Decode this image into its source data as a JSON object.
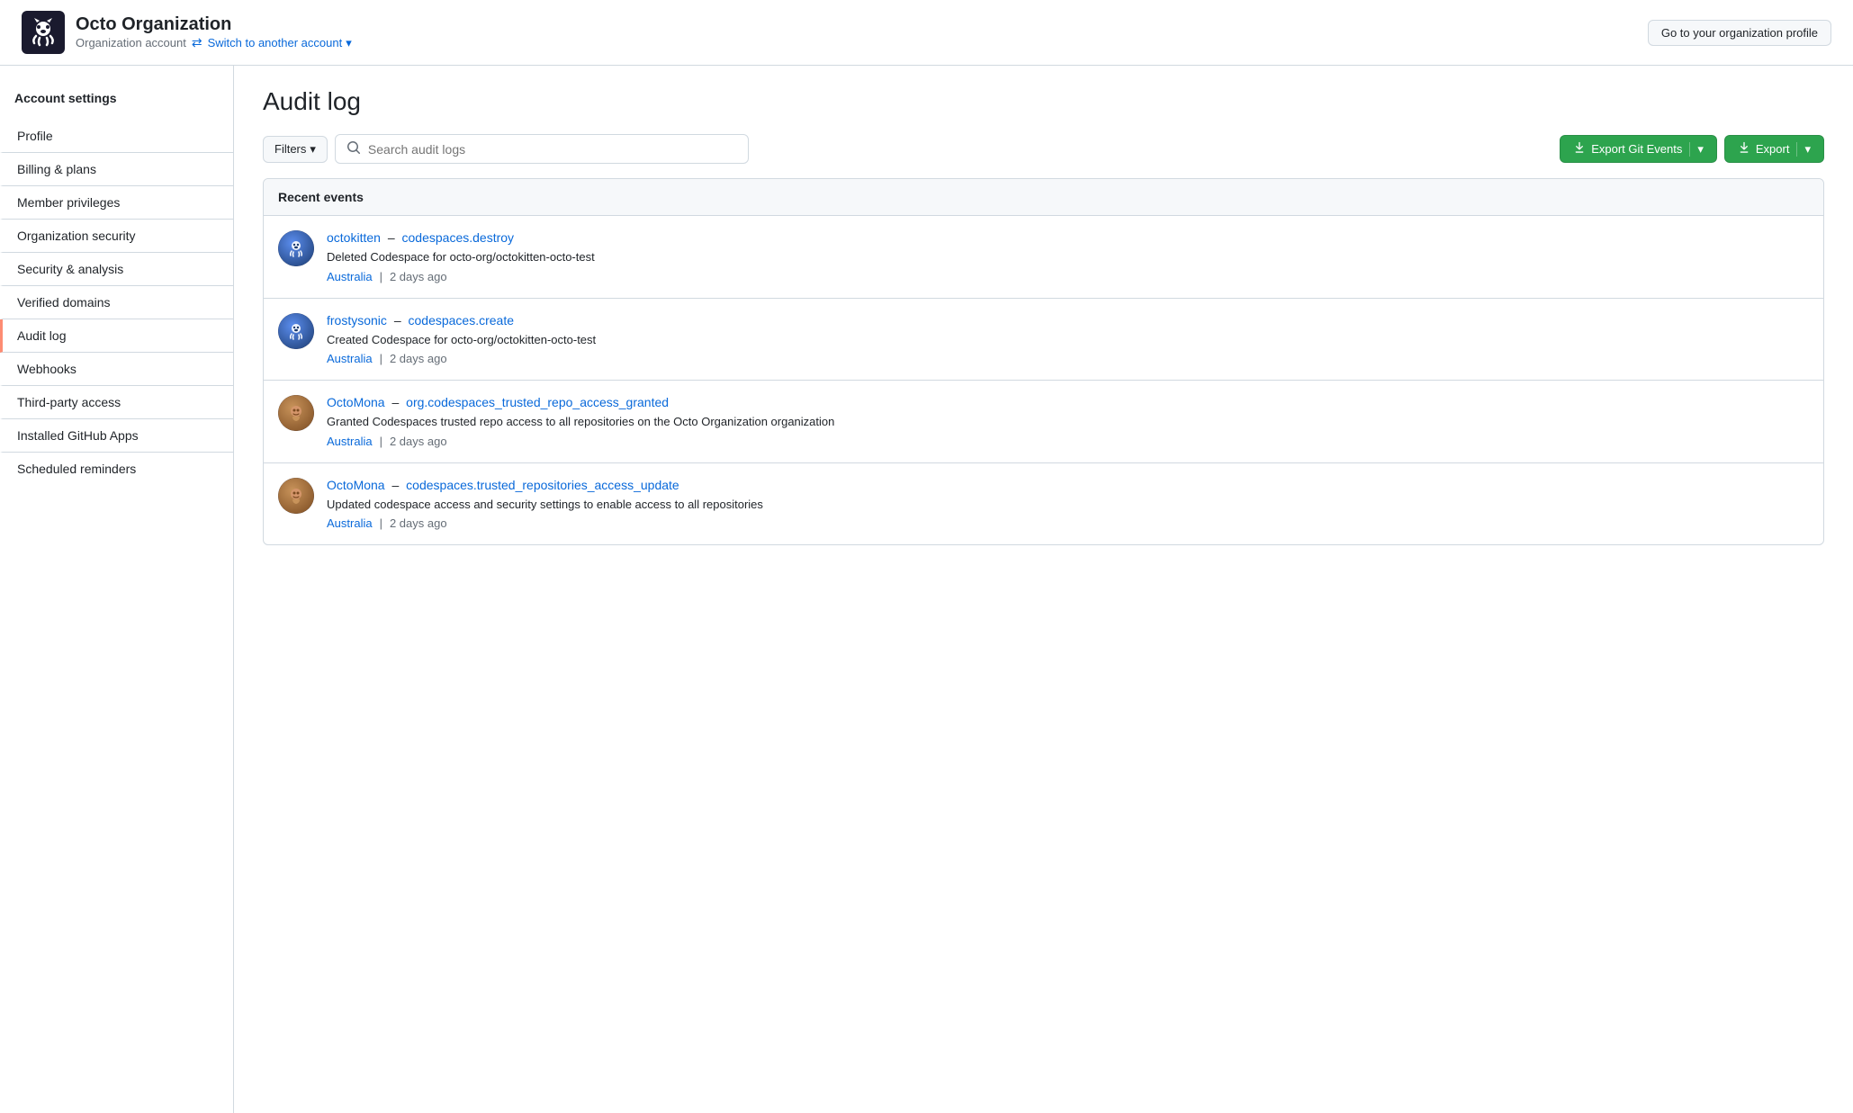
{
  "header": {
    "org_name": "Octo Organization",
    "org_type": "Organization account",
    "switch_label": "Switch to another account",
    "profile_btn": "Go to your organization profile"
  },
  "sidebar": {
    "title": "Account settings",
    "items": [
      {
        "label": "Profile",
        "active": false
      },
      {
        "label": "Billing & plans",
        "active": false
      },
      {
        "label": "Member privileges",
        "active": false
      },
      {
        "label": "Organization security",
        "active": false
      },
      {
        "label": "Security & analysis",
        "active": false
      },
      {
        "label": "Verified domains",
        "active": false
      },
      {
        "label": "Audit log",
        "active": true
      },
      {
        "label": "Webhooks",
        "active": false
      },
      {
        "label": "Third-party access",
        "active": false
      },
      {
        "label": "Installed GitHub Apps",
        "active": false
      },
      {
        "label": "Scheduled reminders",
        "active": false
      }
    ]
  },
  "main": {
    "page_title": "Audit log",
    "toolbar": {
      "filters_label": "Filters",
      "search_placeholder": "Search audit logs",
      "export_git_label": "Export Git Events",
      "export_label": "Export"
    },
    "events_section": {
      "header": "Recent events",
      "items": [
        {
          "user": "octokitten",
          "action": "codespaces.destroy",
          "description": "Deleted Codespace for octo-org/octokitten-octo-test",
          "location": "Australia",
          "time": "2 days ago",
          "avatar_type": "blue"
        },
        {
          "user": "frostysonic",
          "action": "codespaces.create",
          "description": "Created Codespace for octo-org/octokitten-octo-test",
          "location": "Australia",
          "time": "2 days ago",
          "avatar_type": "blue"
        },
        {
          "user": "OctoMona",
          "action": "org.codespaces_trusted_repo_access_granted",
          "description": "Granted Codespaces trusted repo access to all repositories on the Octo Organization organization",
          "location": "Australia",
          "time": "2 days ago",
          "avatar_type": "brown"
        },
        {
          "user": "OctoMona",
          "action": "codespaces.trusted_repositories_access_update",
          "description": "Updated codespace access and security settings to enable access to all repositories",
          "location": "Australia",
          "time": "2 days ago",
          "avatar_type": "brown"
        }
      ]
    }
  }
}
